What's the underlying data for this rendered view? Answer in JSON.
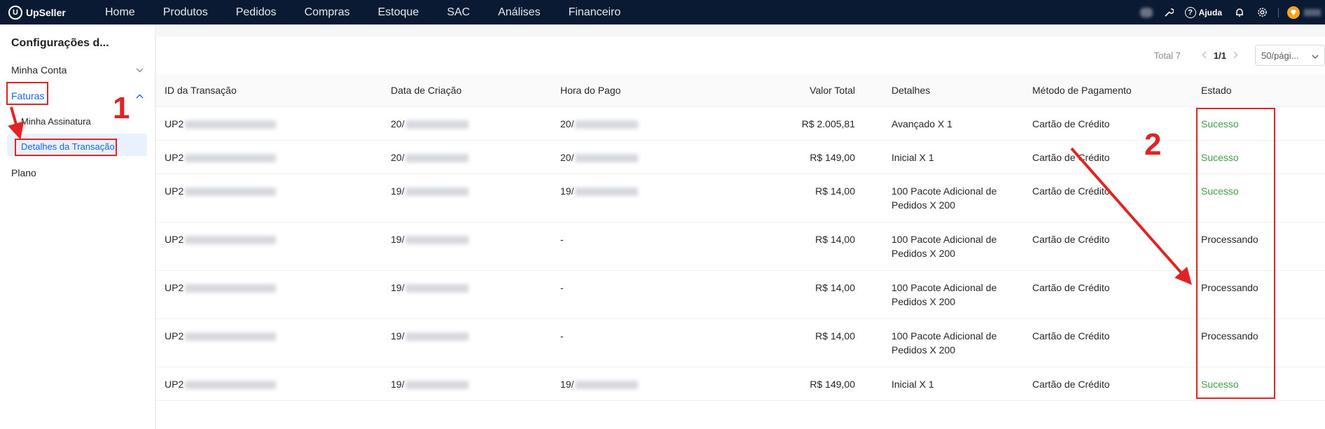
{
  "topbar": {
    "logo": "UpSeller",
    "nav": [
      "Home",
      "Produtos",
      "Pedidos",
      "Compras",
      "Estoque",
      "SAC",
      "Análises",
      "Financeiro"
    ],
    "help": "Ajuda"
  },
  "sidebar": {
    "title": "Configurações d...",
    "items": {
      "conta": "Minha Conta",
      "faturas": "Faturas",
      "assinatura": "Minha Assinatura",
      "detalhes": "Detalhes da Transação",
      "plano": "Plano"
    }
  },
  "pagination": {
    "total": "Total 7",
    "current": "1/1",
    "page_size": "50/pági..."
  },
  "table": {
    "headers": [
      "ID da Transação",
      "Data de Criação",
      "Hora do Pago",
      "Valor Total",
      "Detalhes",
      "Método de Pagamento",
      "Estado"
    ],
    "rows": [
      {
        "id": "UP2",
        "created": "20/",
        "paid": "20/",
        "value": "R$ 2.005,81",
        "d1": "Avançado X 1",
        "d2": "",
        "method": "Cartão de Crédito",
        "status": "Sucesso"
      },
      {
        "id": "UP2",
        "created": "20/",
        "paid": "20/",
        "value": "R$ 149,00",
        "d1": "Inicial X 1",
        "d2": "",
        "method": "Cartão de Crédito",
        "status": "Sucesso"
      },
      {
        "id": "UP2",
        "created": "19/",
        "paid": "19/",
        "value": "R$ 14,00",
        "d1": "100 Pacote Adicional de",
        "d2": "Pedidos X 200",
        "method": "Cartão de Crédito",
        "status": "Sucesso"
      },
      {
        "id": "UP2",
        "created": "19/",
        "paid": "-",
        "value": "R$ 14,00",
        "d1": "100 Pacote Adicional de",
        "d2": "Pedidos X 200",
        "method": "Cartão de Crédito",
        "status": "Processando"
      },
      {
        "id": "UP2",
        "created": "19/",
        "paid": "-",
        "value": "R$ 14,00",
        "d1": "100 Pacote Adicional de",
        "d2": "Pedidos X 200",
        "method": "Cartão de Crédito",
        "status": "Processando"
      },
      {
        "id": "UP2",
        "created": "19/",
        "paid": "-",
        "value": "R$ 14,00",
        "d1": "100 Pacote Adicional de",
        "d2": "Pedidos X 200",
        "method": "Cartão de Crédito",
        "status": "Processando"
      },
      {
        "id": "UP2",
        "created": "19/",
        "paid": "19/",
        "value": "R$ 149,00",
        "d1": "Inicial X 1",
        "d2": "",
        "method": "Cartão de Crédito",
        "status": "Sucesso"
      }
    ]
  },
  "annotations": {
    "one": "1",
    "two": "2"
  },
  "colors": {
    "topbar": "#0b1a33",
    "accent": "#1a66e0",
    "success": "#43a047",
    "annotation": "#e02424"
  },
  "icons": [
    "logo-icon",
    "wrench-icon",
    "help-icon",
    "bell-icon",
    "gear-icon",
    "gem-icon",
    "chevron-down-icon",
    "chevron-up-icon",
    "chevron-left-icon",
    "chevron-right-icon"
  ]
}
